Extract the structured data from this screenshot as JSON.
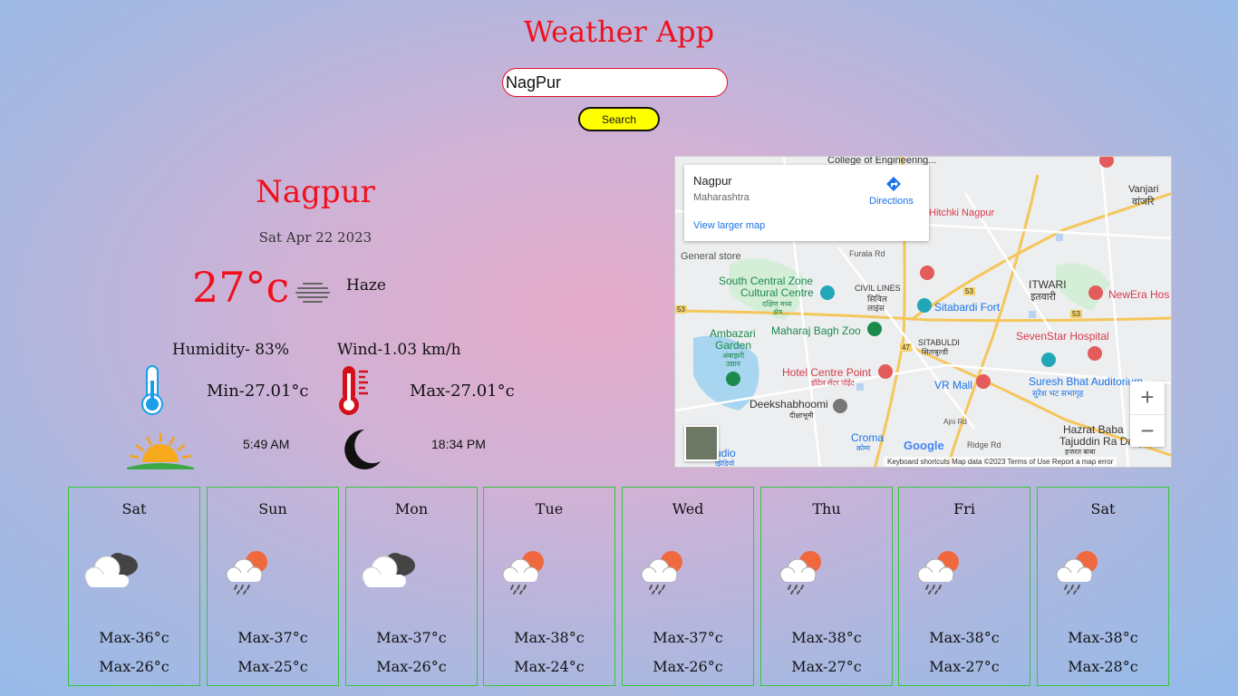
{
  "app": {
    "title": "Weather App"
  },
  "search": {
    "value": "NagPur",
    "button_label": "Search"
  },
  "current": {
    "city": "Nagpur",
    "date": "Sat Apr 22 2023",
    "temperature": "27°c",
    "condition": "Haze",
    "humidity": "Humidity- 83%",
    "wind": "Wind-1.03 km/h",
    "min": "Min-27.01°c",
    "max": "Max-27.01°c",
    "sunrise": "5:49 AM",
    "sunset": "18:34 PM",
    "accent_color": "#f0101d"
  },
  "map": {
    "card": {
      "title": "Nagpur",
      "subtitle": "Maharashtra",
      "larger_map": "View larger map",
      "directions": "Directions"
    },
    "labels": {
      "college": "College of Engineering...",
      "vanjari": "Vanjari",
      "vanjari_hi": "वांजरि",
      "hitchki": "Hitchki Nagpur",
      "general_store": "General store",
      "furala": "Furala Rd",
      "south_central": "South Central Zone",
      "cultural": "Cultural Centre",
      "sc_hi1": "दक्षिण मध्य",
      "sc_hi2": "क्षेत्र...",
      "civil_lines": "CIVIL LINES",
      "civil_hi1": "सिविल",
      "civil_hi2": "लाइंस",
      "itwari": "ITWARI",
      "itwari_hi": "इतवारी",
      "newera": "NewEra Hos",
      "sitabardi_fort": "Sitabardi Fort",
      "ambazari": "Ambazari",
      "garden": "Garden",
      "garden_hi1": "अंबाझरी",
      "garden_hi2": "उद्यान",
      "maharaj": "Maharaj Bagh Zoo",
      "sitabuldi": "SITABULDI",
      "sitabuldi_hi": "सिताबुल्डी",
      "sevenstar": "SevenStar Hospital",
      "hotel": "Hotel Centre Point",
      "hotel_hi": "हॉटेल सेंटर पॉईंट",
      "vr_mall": "VR Mall",
      "suresh": "Suresh Bhat Auditorium",
      "suresh_hi": "सुरेश भट सभागृह",
      "deeksha": "Deekshabhoomi",
      "deeksha_hi": "दीक्षाभूमी",
      "ajni": "Ajni Rd",
      "hazrat1": "Hazrat Baba",
      "hazrat2": "Tajuddin Ra Dargah",
      "hazrat_hi": "हजरत बाबा",
      "croma": "Croma",
      "croma_hi": "क्रोमा",
      "ridge": "Ridge Rd",
      "studio": "udio",
      "studio_hi": "झिडियो",
      "r53a": "53",
      "r53b": "53",
      "r53c": "53",
      "r47": "47"
    },
    "google": "Google",
    "footer": "Keyboard shortcuts    Map data ©2023    Terms of Use    Report a map error",
    "zoom_in": "+",
    "zoom_out": "−"
  },
  "forecast": [
    {
      "day": "Sat",
      "max": "Max-36°c",
      "min": "Max-26°c",
      "icon": "cloudy-icon"
    },
    {
      "day": "Sun",
      "max": "Max-37°c",
      "min": "Max-25°c",
      "icon": "rain-sun-icon"
    },
    {
      "day": "Mon",
      "max": "Max-37°c",
      "min": "Max-26°c",
      "icon": "cloudy-icon"
    },
    {
      "day": "Tue",
      "max": "Max-38°c",
      "min": "Max-24°c",
      "icon": "rain-sun-icon"
    },
    {
      "day": "Wed",
      "max": "Max-37°c",
      "min": "Max-26°c",
      "icon": "rain-sun-icon"
    },
    {
      "day": "Thu",
      "max": "Max-38°c",
      "min": "Max-27°c",
      "icon": "rain-sun-icon"
    },
    {
      "day": "Fri",
      "max": "Max-38°c",
      "min": "Max-27°c",
      "icon": "rain-sun-icon"
    },
    {
      "day": "Sat",
      "max": "Max-38°c",
      "min": "Max-28°c",
      "icon": "rain-sun-icon"
    }
  ]
}
